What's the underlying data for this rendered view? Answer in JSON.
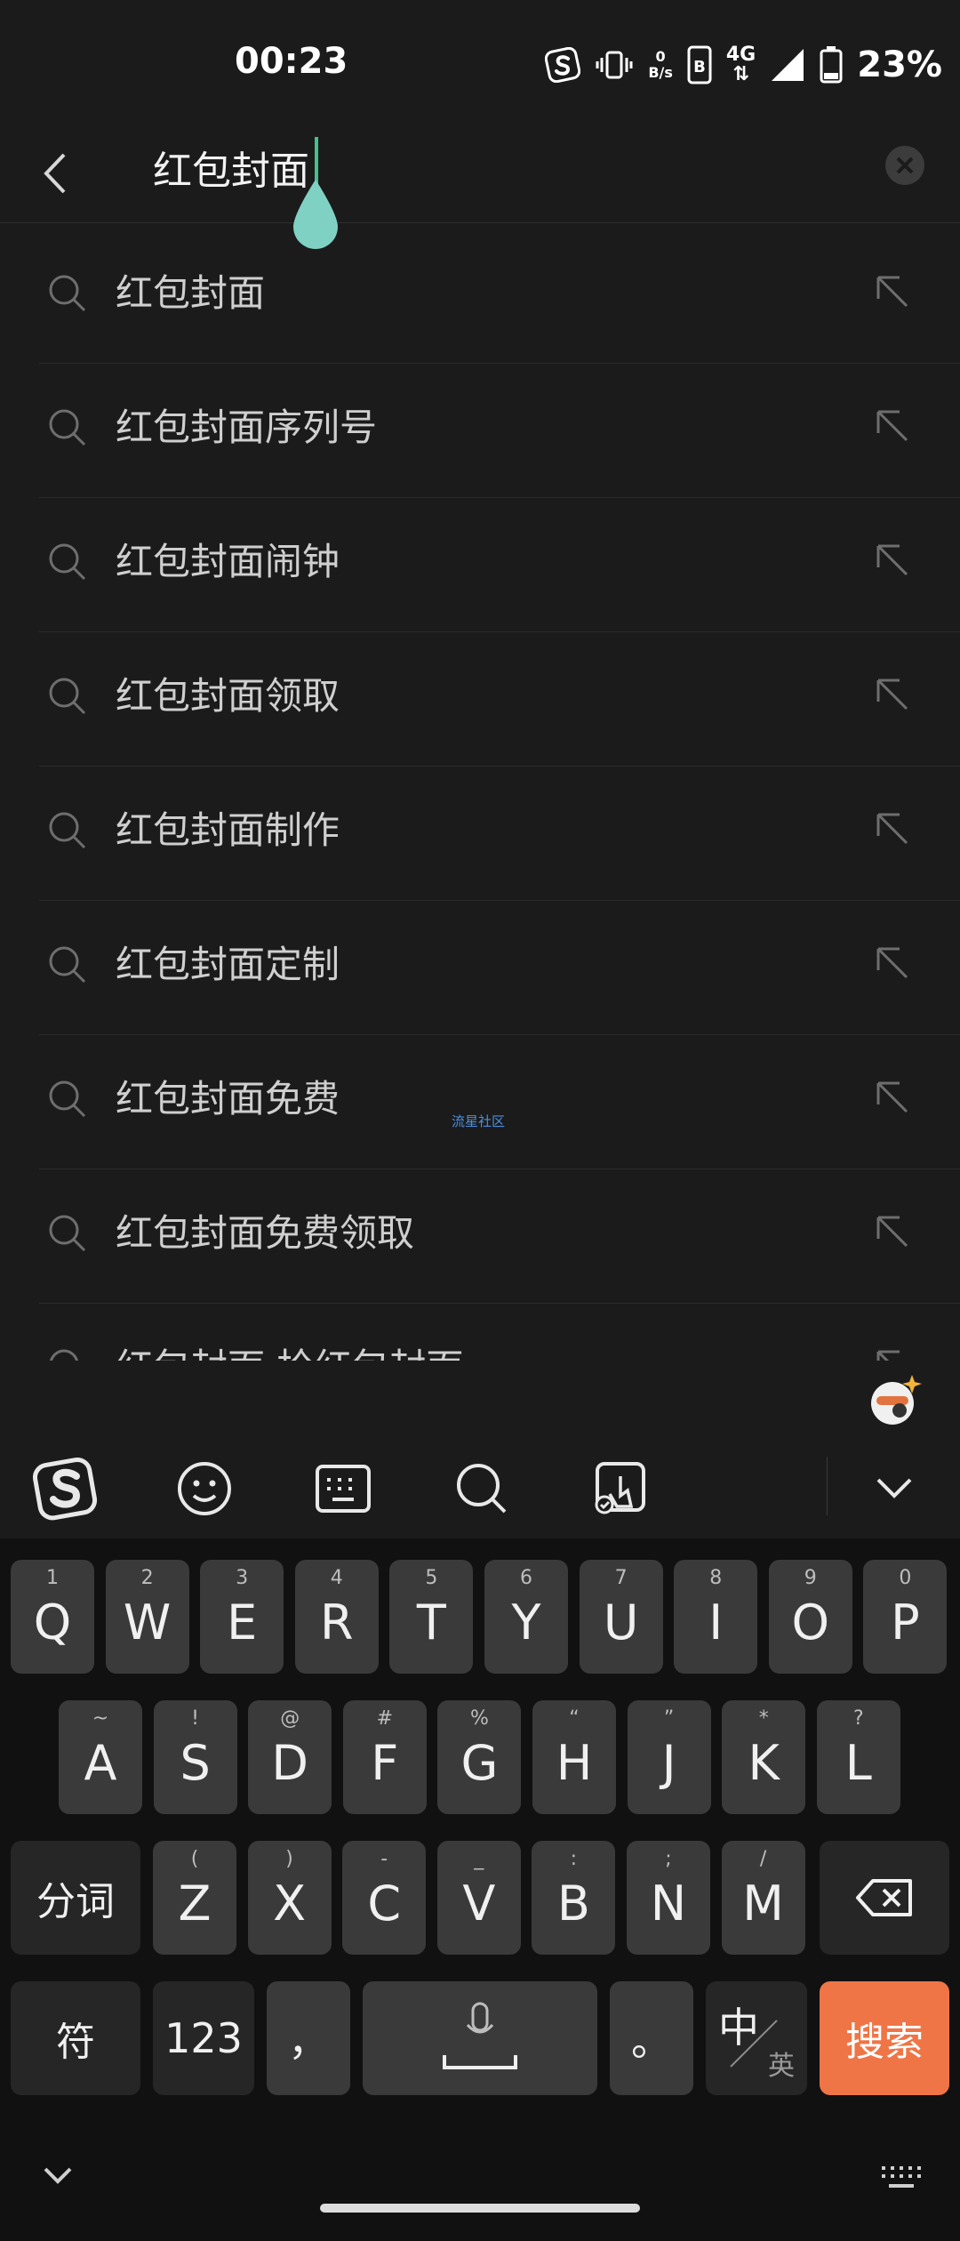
{
  "status_bar": {
    "time": "00:23",
    "net_speed_value": "0",
    "net_speed_unit": "B/s",
    "network": "4G",
    "battery_percent": "23%"
  },
  "search": {
    "query": "红包封面"
  },
  "suggestions": [
    "红包封面",
    "红包封面序列号",
    "红包封面闹钟",
    "红包封面领取",
    "红包封面制作",
    "红包封面定制",
    "红包封面免费",
    "红包封面免费领取",
    "红包封面 抢红包封面"
  ],
  "watermark": "流星社区",
  "keyboard": {
    "row1": [
      {
        "key": "Q",
        "sub": "1"
      },
      {
        "key": "W",
        "sub": "2"
      },
      {
        "key": "E",
        "sub": "3"
      },
      {
        "key": "R",
        "sub": "4"
      },
      {
        "key": "T",
        "sub": "5"
      },
      {
        "key": "Y",
        "sub": "6"
      },
      {
        "key": "U",
        "sub": "7"
      },
      {
        "key": "I",
        "sub": "8"
      },
      {
        "key": "O",
        "sub": "9"
      },
      {
        "key": "P",
        "sub": "0"
      }
    ],
    "row2": [
      {
        "key": "A",
        "sub": "~"
      },
      {
        "key": "S",
        "sub": "!"
      },
      {
        "key": "D",
        "sub": "@"
      },
      {
        "key": "F",
        "sub": "#"
      },
      {
        "key": "G",
        "sub": "%"
      },
      {
        "key": "H",
        "sub": "“"
      },
      {
        "key": "J",
        "sub": "”"
      },
      {
        "key": "K",
        "sub": "*"
      },
      {
        "key": "L",
        "sub": "?"
      }
    ],
    "row3": [
      {
        "key": "Z",
        "sub": "("
      },
      {
        "key": "X",
        "sub": ")"
      },
      {
        "key": "C",
        "sub": "-"
      },
      {
        "key": "V",
        "sub": "_"
      },
      {
        "key": "B",
        "sub": ":"
      },
      {
        "key": "N",
        "sub": ";"
      },
      {
        "key": "M",
        "sub": "/"
      }
    ],
    "segment_label": "分词",
    "symbol_label": "符",
    "numeric_label": "123",
    "comma_label": "，",
    "period_label": "。",
    "chinese_label": "中",
    "english_label": "英",
    "search_label": "搜索"
  },
  "colors": {
    "accent_search": "#ef7546",
    "caret": "#46c08a",
    "drop_handle": "#7fd1c4"
  }
}
